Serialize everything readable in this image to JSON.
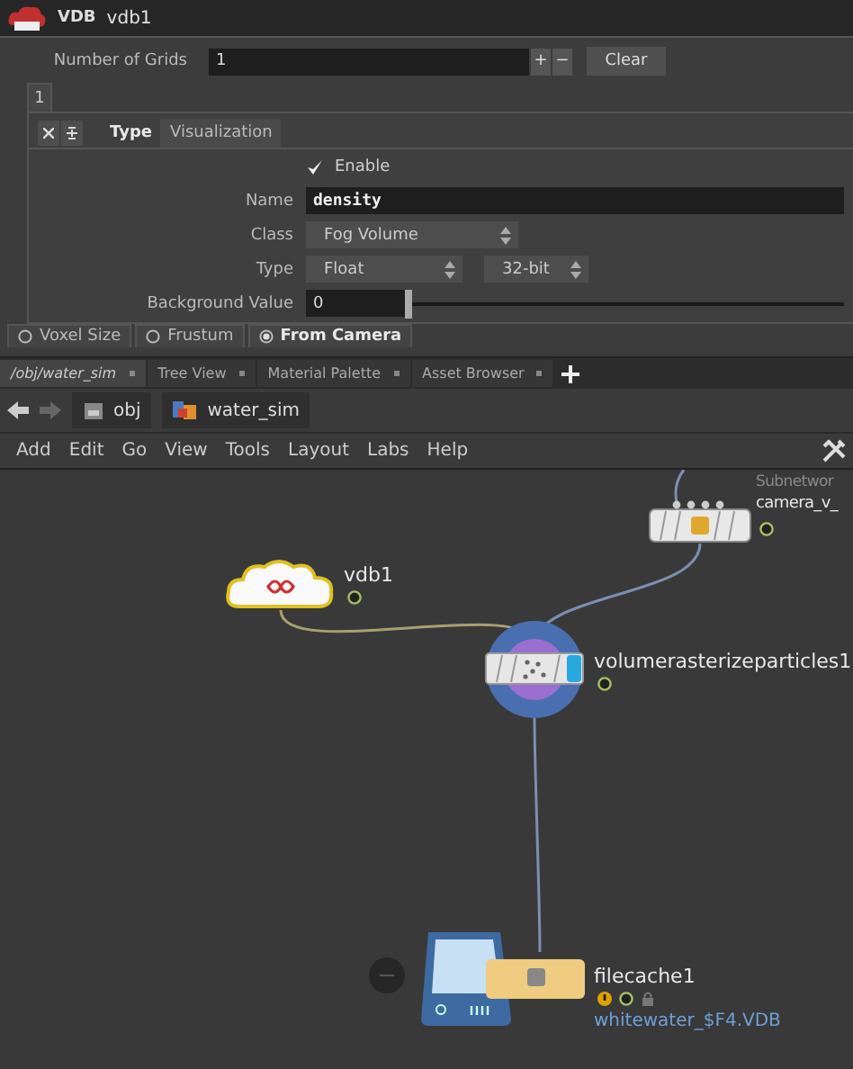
{
  "node_header": {
    "type": "VDB",
    "name": "vdb1"
  },
  "grid_count": {
    "label": "Number of Grids",
    "value": "1",
    "add": "+",
    "remove": "−",
    "clear": "Clear"
  },
  "multiparm_tab": {
    "label": "1",
    "selected": true
  },
  "tabs": [
    {
      "label": "Type",
      "selected": true
    },
    {
      "label": "Visualization",
      "selected": false
    }
  ],
  "enable": {
    "label": "Enable",
    "checked": true
  },
  "fields": [
    {
      "kind": "text",
      "label": "Name",
      "value": "density"
    },
    {
      "kind": "menu",
      "label": "Class",
      "value": "Fog Volume"
    },
    {
      "kind": "menu2",
      "label": "Type",
      "value": "Float",
      "value2": "32-bit"
    },
    {
      "kind": "slider",
      "label": "Background Value",
      "value": "0",
      "level": 0
    }
  ],
  "radios": [
    {
      "label": "Voxel Size",
      "selected": false
    },
    {
      "label": "Frustum",
      "selected": false
    },
    {
      "label": "From Camera",
      "selected": true
    }
  ],
  "pane_tabs": [
    {
      "label": "/obj/water_sim",
      "selected": true
    },
    {
      "label": "Tree View",
      "selected": false
    },
    {
      "label": "Material Palette",
      "selected": false
    },
    {
      "label": "Asset Browser",
      "selected": false
    }
  ],
  "path": [
    "obj",
    "water_sim"
  ],
  "menu": [
    "Add",
    "Edit",
    "Go",
    "View",
    "Tools",
    "Layout",
    "Labs",
    "Help"
  ],
  "nodes": [
    {
      "kind": "subnet",
      "name": "camera_v_",
      "type_label": "Subnetwor"
    },
    {
      "kind": "vdb",
      "name": "vdb1"
    },
    {
      "kind": "rasterize",
      "name": "volumerasterizeparticles1"
    },
    {
      "kind": "filecache",
      "name": "filecache1",
      "file": "whitewater_$F4.VDB"
    }
  ]
}
